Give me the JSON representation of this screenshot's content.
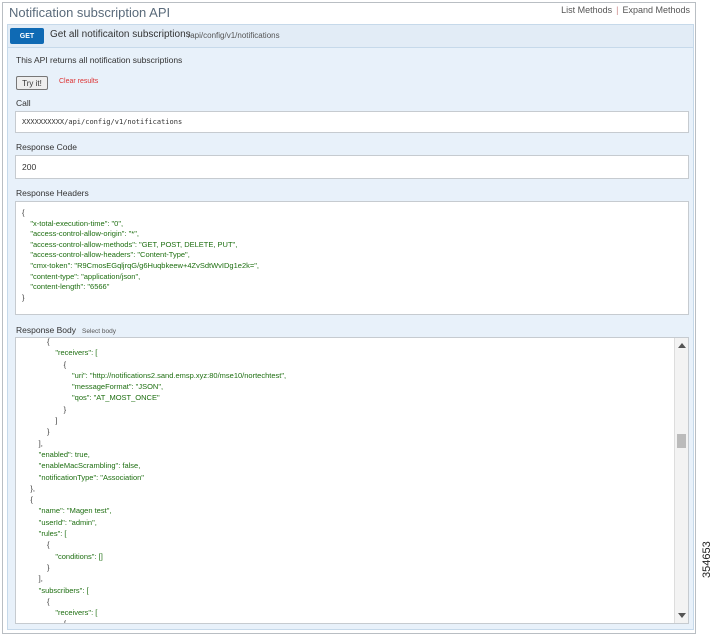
{
  "header": {
    "title": "Notification subscription API",
    "list_methods": "List Methods",
    "separator": "|",
    "expand_methods": "Expand Methods"
  },
  "operation": {
    "method": "GET",
    "summary": "Get all notificaiton subscriptions",
    "path": "/api/config/v1/notifications",
    "description": "This API returns all notification subscriptions",
    "try_button": "Try it!",
    "clear_link": "Clear results"
  },
  "call": {
    "label": "Call",
    "url_prefix": "XXXXXXXXXX",
    "url_suffix": "/api/config/v1/notifications"
  },
  "response_code": {
    "label": "Response Code",
    "value": "200"
  },
  "response_headers": {
    "label": "Response Headers",
    "lines": [
      "{",
      "    \"x-total-execution-time\": \"0\",",
      "    \"access-control-allow-origin\": \"*\",",
      "    \"access-control-allow-methods\": \"GET, POST, DELETE, PUT\",",
      "    \"access-control-allow-headers\": \"Content-Type\",",
      "    \"cmx-token\": \"R9CmosEGqljrqG/g6Huqbkeew+4ZvSdtWvIDg1e2k=\",",
      "    \"content-type\": \"application/json\",",
      "    \"content-length\": \"6566\"",
      "}"
    ]
  },
  "response_body": {
    "label": "Response Body",
    "select_link": "Select body",
    "lines": [
      "            {",
      "                \"receivers\": [",
      "                    {",
      "                        \"uri\": \"http://notifications2.sand.emsp.xyz:80/mse10/nortechtest\",",
      "                        \"messageFormat\": \"JSON\",",
      "                        \"qos\": \"AT_MOST_ONCE\"",
      "                    }",
      "                ]",
      "            }",
      "        ],",
      "        \"enabled\": true,",
      "        \"enableMacScrambling\": false,",
      "        \"notificationType\": \"Association\"",
      "    },",
      "    {",
      "        \"name\": \"Magen test\",",
      "        \"userId\": \"admin\",",
      "        \"rules\": [",
      "            {",
      "                \"conditions\": []",
      "            }",
      "        ],",
      "        \"subscribers\": [",
      "            {",
      "                \"receivers\": [",
      "                    {"
    ]
  },
  "figure_id": "354653"
}
